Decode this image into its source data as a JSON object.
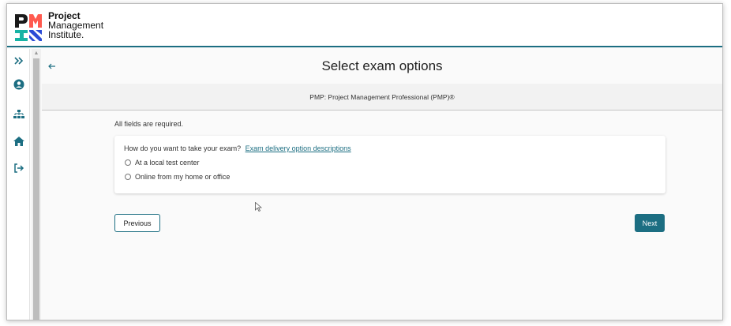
{
  "logo": {
    "line1": "Project",
    "line2": "Management",
    "line3": "Institute."
  },
  "icons": {
    "expand": "double-chevron-right-icon",
    "profile": "user-circle-icon",
    "sitemap": "sitemap-icon",
    "home": "home-icon",
    "logout": "sign-out-icon",
    "back": "arrow-left-icon"
  },
  "page": {
    "title": "Select exam options",
    "exam_name": "PMP: Project Management Professional (PMP)®",
    "required_note": "All fields are required."
  },
  "form": {
    "question": "How do you want to take your exam?",
    "help_link": "Exam delivery option descriptions",
    "options": [
      "At a local test center",
      "Online from my home or office"
    ]
  },
  "buttons": {
    "previous": "Previous",
    "next": "Next"
  },
  "colors": {
    "accent": "#1c6e82",
    "logo_orange": "#ff5a4f",
    "logo_blue": "#2b4bd6",
    "logo_teal": "#17b3a5"
  }
}
